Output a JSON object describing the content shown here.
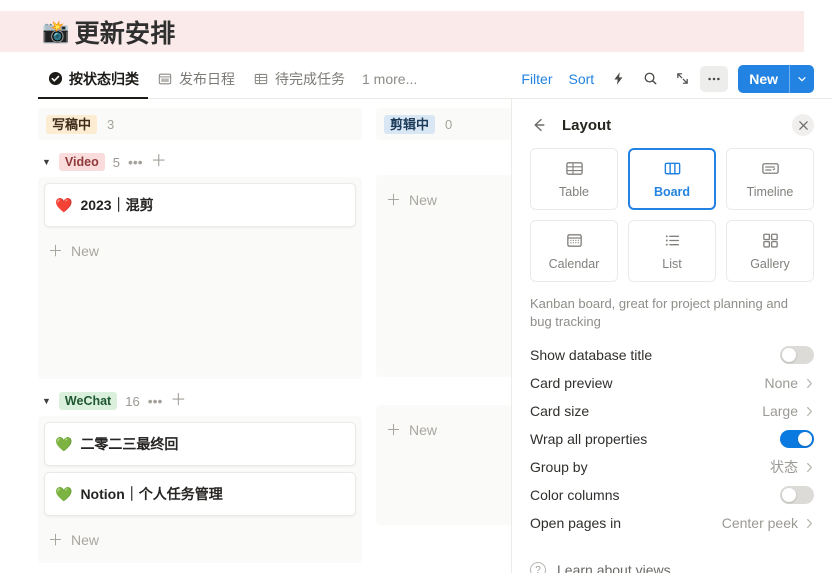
{
  "page": {
    "emoji": "📸",
    "title": "更新安排"
  },
  "view_tabs": [
    {
      "label": "按状态归类",
      "icon": "check-circle-icon",
      "active": true
    },
    {
      "label": "发布日程",
      "icon": "calendar-icon",
      "active": false
    },
    {
      "label": "待完成任务",
      "icon": "table-icon",
      "active": false
    }
  ],
  "tabs_overflow_label": "1 more...",
  "toolbar": {
    "filter_label": "Filter",
    "sort_label": "Sort",
    "automation_icon": "lightning-icon",
    "search_icon": "search-icon",
    "expand_icon": "collapse-arrows-icon",
    "more_icon": "ellipsis-icon",
    "new_label": "New",
    "new_caret_icon": "chevron-down-icon",
    "accent_color": "#2383e2"
  },
  "board": {
    "columns": [
      {
        "name": "写稿中",
        "chip_bg": "#fbecd2",
        "chip_fg": "#402c1b",
        "count": "3",
        "groups": [
          {
            "name": "Video",
            "chip_bg": "#fbdcdc",
            "chip_fg": "#8f3a39",
            "count": "5",
            "cards": [
              {
                "emoji": "❤️",
                "title": "2023｜混剪"
              }
            ],
            "add_label": "New"
          },
          {
            "name": "WeChat",
            "chip_bg": "#daf0dd",
            "chip_fg": "#1f5730",
            "count": "16",
            "cards": [
              {
                "emoji": "💚",
                "title": "二零二三最终回"
              },
              {
                "emoji": "💚",
                "title": "Notion｜个人任务管理"
              }
            ],
            "add_label": "New"
          }
        ]
      },
      {
        "name": "剪辑中",
        "chip_bg": "#d9e7f5",
        "chip_fg": "#1d3c5a",
        "count": "0",
        "groups": [
          {
            "name": "",
            "cards": [],
            "add_label": "New"
          },
          {
            "name": "",
            "cards": [],
            "add_label": "New"
          }
        ]
      }
    ]
  },
  "panel": {
    "back_icon": "arrow-left-icon",
    "title": "Layout",
    "close_icon": "close-icon",
    "layout_options": [
      {
        "label": "Table",
        "icon": "table-layout-icon",
        "selected": false
      },
      {
        "label": "Board",
        "icon": "board-layout-icon",
        "selected": true
      },
      {
        "label": "Timeline",
        "icon": "timeline-layout-icon",
        "selected": false
      },
      {
        "label": "Calendar",
        "icon": "calendar-layout-icon",
        "selected": false
      },
      {
        "label": "List",
        "icon": "list-layout-icon",
        "selected": false
      },
      {
        "label": "Gallery",
        "icon": "gallery-layout-icon",
        "selected": false
      }
    ],
    "description": "Kanban board, great for project planning and bug tracking",
    "settings": [
      {
        "label": "Show database title",
        "type": "toggle",
        "on": false
      },
      {
        "label": "Card preview",
        "type": "value",
        "value": "None"
      },
      {
        "label": "Card size",
        "type": "value",
        "value": "Large"
      },
      {
        "label": "Wrap all properties",
        "type": "toggle",
        "on": true
      },
      {
        "label": "Group by",
        "type": "value",
        "value": "状态"
      },
      {
        "label": "Color columns",
        "type": "toggle",
        "on": false
      },
      {
        "label": "Open pages in",
        "type": "value",
        "value": "Center peek"
      }
    ],
    "learn_label": "Learn about views",
    "learn_icon": "question-circle-icon",
    "selected_color": "#2383e2",
    "toggle_on_color": "#0b7ae0"
  }
}
